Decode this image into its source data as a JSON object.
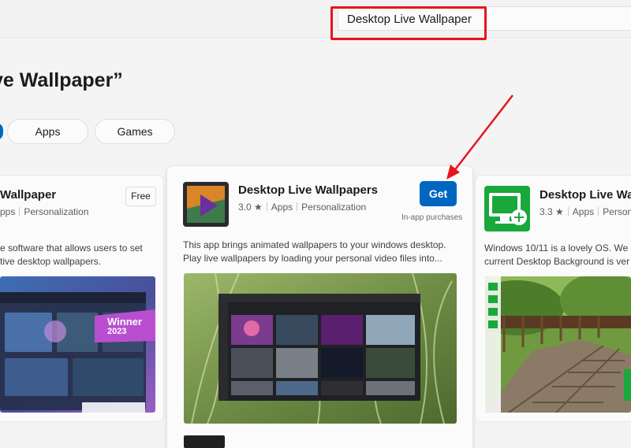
{
  "search": {
    "value": "Desktop Live Wallpaper"
  },
  "results_title": "ve Wallpaper”",
  "filters": [
    "Apps",
    "Games"
  ],
  "cards": [
    {
      "title": "Wallpaper",
      "meta_a": "pps",
      "meta_b": "Personalization",
      "price_label": "Free",
      "desc_1": "e software that allows users to set",
      "desc_2": "tive desktop wallpapers.",
      "badge_main": "Winner",
      "badge_year": "2023"
    },
    {
      "title": "Desktop Live Wallpapers",
      "rating": "3.0 ★",
      "meta_a": "Apps",
      "meta_b": "Personalization",
      "button_label": "Get",
      "inapp_label": "In-app purchases",
      "desc_1": "This app brings animated wallpapers to your windows desktop.",
      "desc_2": "Play live wallpapers by loading your personal video files into..."
    },
    {
      "title": "Desktop Live Wall",
      "rating": "3.3 ★",
      "meta_a": "Apps",
      "meta_b": "Persona",
      "desc_1": "Windows 10/11 is a lovely OS. We",
      "desc_2": "current Desktop Background is ver"
    }
  ],
  "colors": {
    "accent": "#0067c0",
    "annotation": "#e8141c"
  }
}
